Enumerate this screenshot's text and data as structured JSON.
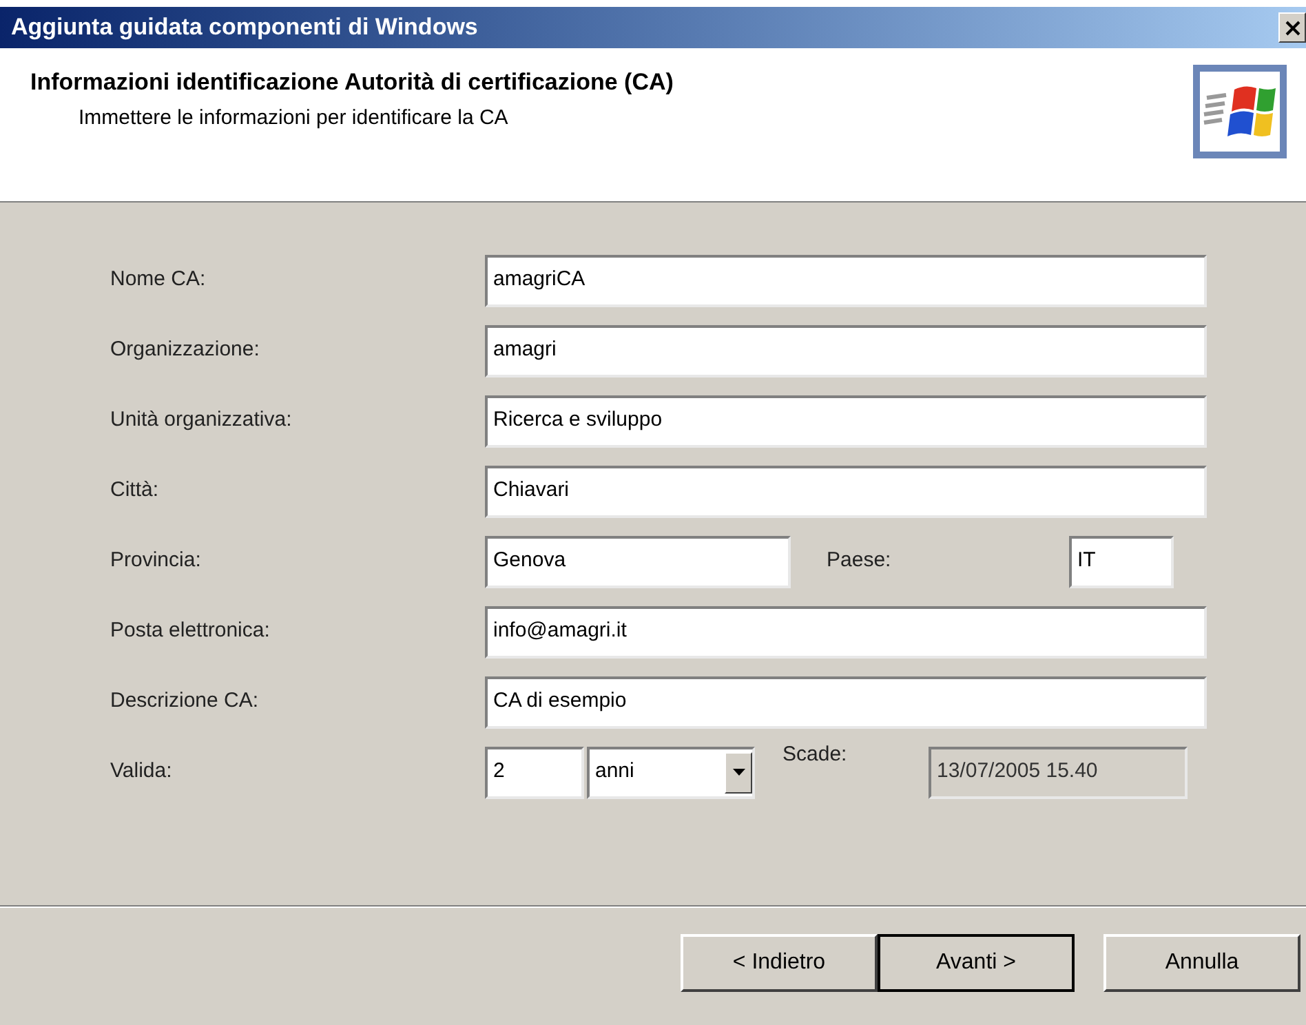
{
  "window": {
    "title": "Aggiunta guidata componenti di Windows"
  },
  "header": {
    "title": "Informazioni identificazione Autorità di certificazione (CA)",
    "subtitle": "Immettere le informazioni per identificare la CA"
  },
  "fields": [
    {
      "kind": "text",
      "label": "Nome CA:",
      "value": "amagriCA"
    },
    {
      "kind": "text",
      "label": "Organizzazione:",
      "value": "amagri"
    },
    {
      "kind": "text",
      "label": "Unità organizzativa:",
      "value": "Ricerca e sviluppo"
    },
    {
      "kind": "text",
      "label": "Città:",
      "value": "Chiavari"
    },
    {
      "kind": "pair",
      "label": "Provincia:",
      "value": "Genova",
      "label_2": "Paese:",
      "value_2": "IT"
    },
    {
      "kind": "text",
      "label": "Posta elettronica:",
      "value": "info@amagri.it"
    },
    {
      "kind": "text",
      "label": "Descrizione CA:",
      "value": "CA di esempio"
    },
    {
      "kind": "validity",
      "label": "Valida:",
      "value": "2",
      "unit": "anni",
      "label_2": "Scade:",
      "value_2": "13/07/2005 15.40"
    }
  ],
  "buttons": [
    {
      "label": "< Indietro",
      "default": false
    },
    {
      "label": "Avanti >",
      "default": true
    },
    {
      "label": "Annulla",
      "default": false
    }
  ]
}
